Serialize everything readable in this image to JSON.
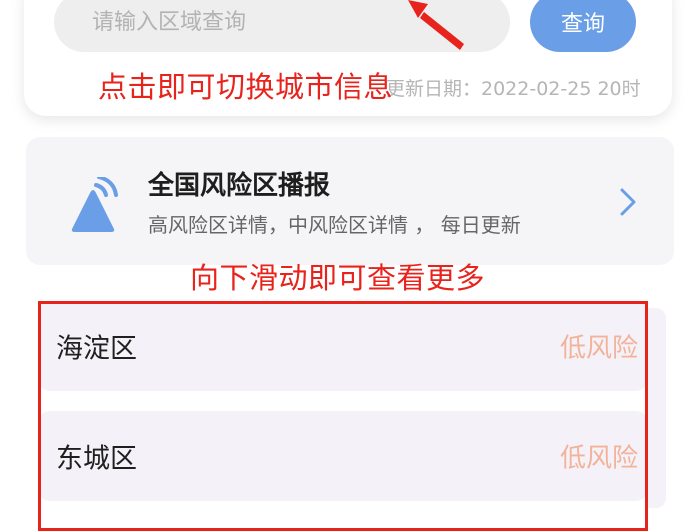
{
  "search": {
    "placeholder": "请输入区域查询",
    "button_label": "查询",
    "update_date": "更新日期：2022-02-25 20时"
  },
  "annotations": {
    "switch_city": "点击即可切换城市信息",
    "scroll_more": "向下滑动即可查看更多"
  },
  "broadcast": {
    "title": "全国风险区播报",
    "subtitle": "高风险区详情，中风险区详情 ， 每日更新",
    "icon": "broadcast-icon"
  },
  "districts": [
    {
      "name": "海淀区",
      "risk": "低风险"
    },
    {
      "name": "东城区",
      "risk": "低风险"
    }
  ],
  "colors": {
    "accent": "#6a9ee6",
    "annotation_red": "#e8231c",
    "risk_low": "#f2b39a",
    "card_bg": "#f5f5f7",
    "list_bg": "#f4f2f8"
  }
}
